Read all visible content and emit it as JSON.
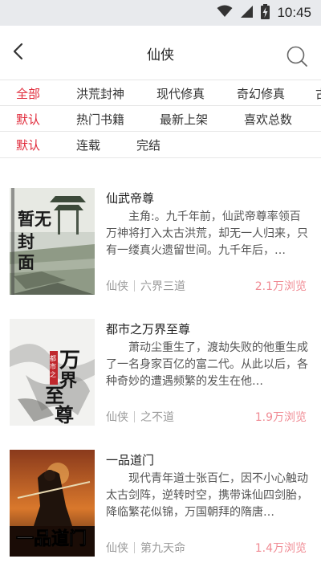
{
  "status_bar": {
    "time": "10:45",
    "icons": [
      "wifi-icon",
      "signal-icon",
      "battery-charging-icon"
    ]
  },
  "header": {
    "title": "仙侠",
    "back_icon": "chevron-left-icon",
    "search_icon": "search-icon"
  },
  "filters": {
    "categories": [
      "全部",
      "洪荒封神",
      "现代修真",
      "奇幻修真",
      "古"
    ],
    "sort": [
      "默认",
      "热门书籍",
      "最新上架",
      "喜欢总数"
    ],
    "status": [
      "默认",
      "连载",
      "完结"
    ]
  },
  "books": [
    {
      "title": "仙武帝尊",
      "description": "主角:。九千年前，仙武帝尊率领百万神将打入太古洪荒，却无一人归来，只有一缕真火遗留世间。九千年后，…",
      "category": "仙侠",
      "author": "六界三道",
      "views": "2.1万浏览",
      "cover_text": "暂无封面"
    },
    {
      "title": "都市之万界至尊",
      "description": "萧动尘重生了，渡劫失败的他重生成了一名身家百亿的富二代。从此以后，各种奇妙的遭遇频繁的发生在他…",
      "category": "仙侠",
      "author": "之不道",
      "views": "1.9万浏览",
      "cover_text": "万界至尊"
    },
    {
      "title": "一品道门",
      "description": "现代青年道士张百仁，因不小心触动太古剑阵，逆转时空，携带诛仙四剑胎，降临繁花似锦，万国朝拜的隋唐…",
      "category": "仙侠",
      "author": "第九天命",
      "views": "1.4万浏览",
      "cover_text": "一品道门"
    }
  ],
  "colors": {
    "accent": "#e02a3a",
    "views": "#f08b94",
    "status_bar": "#e8eaed"
  }
}
